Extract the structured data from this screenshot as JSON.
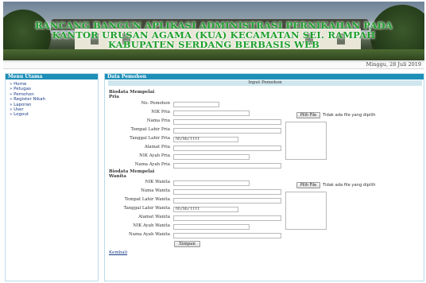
{
  "banner": {
    "title_line1": "RANCANG BANGUN APLIKASI ADMINISTRASI PERNIKAHAN PADA",
    "title_line2": "KANTOR URUSAN AGAMA (KUA) KECAMATAN SEI. RAMPAH",
    "title_line3": "KABUPATEN SERDANG BERBASIS WEB"
  },
  "date": "Minggu, 28 Juli 2019",
  "menu": {
    "title": "Menu Utama",
    "items": [
      {
        "label": "Home"
      },
      {
        "label": "Petugas"
      },
      {
        "label": "Pemohon"
      },
      {
        "label": "Register Nikah"
      },
      {
        "label": "Laporan"
      },
      {
        "label": "User"
      },
      {
        "label": "Logout"
      }
    ]
  },
  "content": {
    "title": "Data Pemohon",
    "form_title": "Input Pemohon",
    "no_pemohon_label": "No. Pemohon",
    "pria": {
      "section": "Biodata Mempelai Pria",
      "nik": "NIK Pria",
      "nama": "Nama Pria",
      "tempat_lahir": "Tempat Lahir Pria",
      "tanggal_lahir": "Tanggal Lahir Pria",
      "tanggal_placeholder": "hh/bb/tttt",
      "alamat": "Alamat Pria",
      "nik_ayah": "NIK Ayah Pria",
      "nama_ayah": "Nama Ayah Pria",
      "file_button": "Pilih File",
      "file_text": "Tidak ada file yang dipilih"
    },
    "wanita": {
      "section": "Biodata Mempelai Wanita",
      "nik": "NIK Wanita",
      "nama": "Nama Wanita",
      "tempat_lahir": "Tempat Lahir Wanita",
      "tanggal_lahir": "Tanggal Lahir Wanita",
      "tanggal_placeholder": "hh/bb/tttt",
      "alamat": "Alamat Wanita",
      "nik_ayah": "NIK Ayah Wanita",
      "nama_ayah": "Nama Ayah Wanita",
      "file_button": "Pilih File",
      "file_text": "Tidak ada file yang dipilih"
    },
    "save_button": "Simpan",
    "back_link": "Kembali"
  }
}
